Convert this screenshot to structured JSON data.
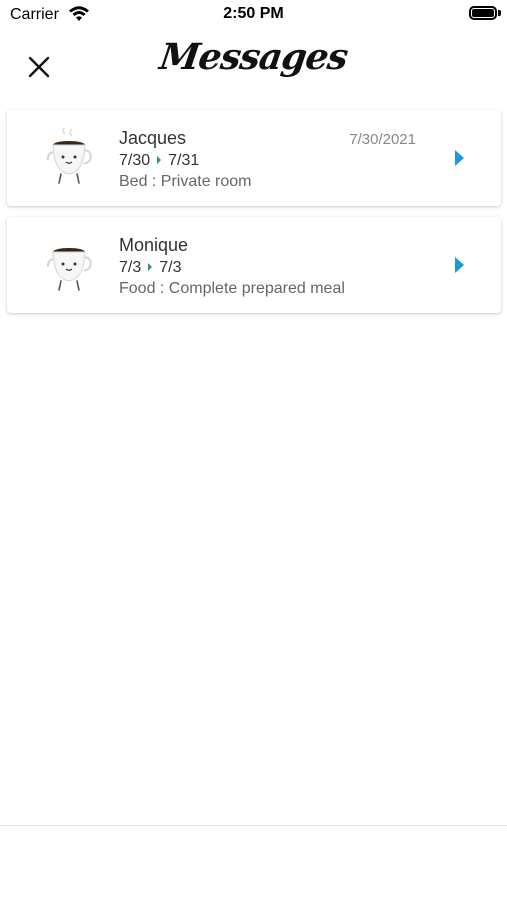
{
  "status_bar": {
    "carrier": "Carrier",
    "time": "2:50 PM"
  },
  "header": {
    "title": "Messages",
    "close_icon": "close-icon"
  },
  "messages": [
    {
      "name": "Jacques",
      "date": "7/30/2021",
      "from": "7/30",
      "to": "7/31",
      "detail": "Bed : Private room",
      "avatar_icon": "coffee-cup-icon"
    },
    {
      "name": "Monique",
      "date": "",
      "from": "7/3",
      "to": "7/3",
      "detail": "Food : Complete prepared meal",
      "avatar_icon": "coffee-cup-icon"
    }
  ],
  "colors": {
    "chevron": "#1a9ad6",
    "date_separator": "#3a8b92"
  }
}
